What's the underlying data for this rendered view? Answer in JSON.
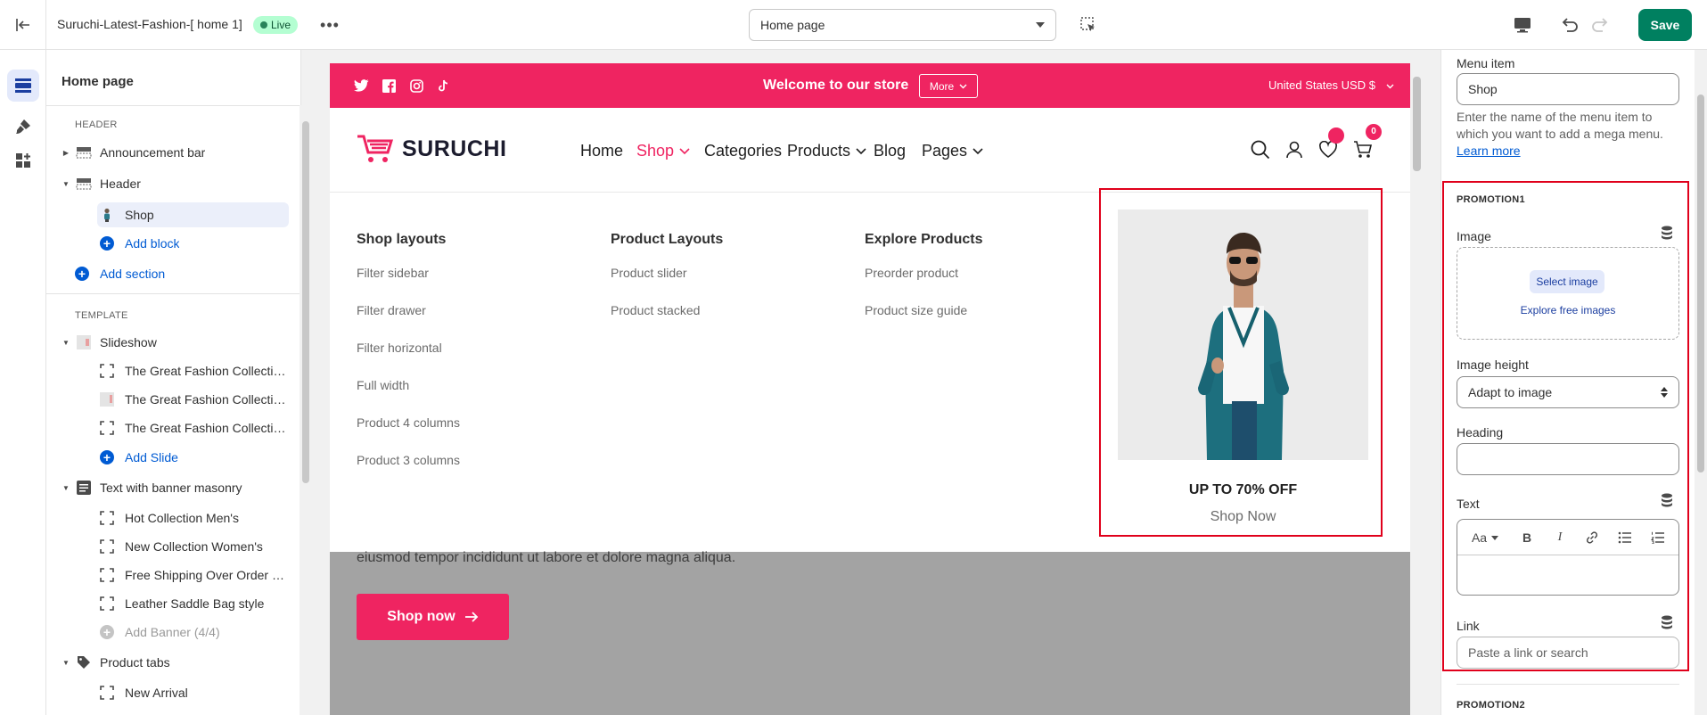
{
  "topbar": {
    "theme_name": "Suruchi-Latest-Fashion-[ home 1]",
    "live_badge": "Live",
    "page_selector": "Home page",
    "save_label": "Save"
  },
  "left_panel": {
    "title": "Home page",
    "header_section_label": "HEADER",
    "template_section_label": "TEMPLATE",
    "items": {
      "announcement_bar": "Announcement bar",
      "header": "Header",
      "shop": "Shop",
      "add_block": "Add block",
      "add_section": "Add section",
      "slideshow": "Slideshow",
      "slide1": "The Great Fashion Collectio...",
      "slide2": "The Great Fashion Collectio...",
      "slide3": "The Great Fashion Collectio...",
      "add_slide": "Add Slide",
      "text_banner": "Text with banner masonry",
      "banner1": "Hot Collection Men's",
      "banner2": "New Collection Women's",
      "banner3": "Free Shipping Over Order $...",
      "banner4": "Leather Saddle Bag style",
      "add_banner": "Add Banner (4/4)",
      "product_tabs": "Product tabs",
      "new_arrival": "New Arrival"
    }
  },
  "preview": {
    "announcement": {
      "text": "Welcome to our store",
      "more": "More",
      "currency": "United States USD $"
    },
    "logo_text": "SURUCHI",
    "nav": [
      "Home",
      "Shop",
      "Categories",
      "Products",
      "Blog",
      "Pages"
    ],
    "cart_count": "0",
    "mega_columns": [
      {
        "title": "Shop layouts",
        "items": [
          "Filter sidebar",
          "Filter drawer",
          "Filter horizontal",
          "Full width",
          "Product 4 columns",
          "Product 3 columns"
        ]
      },
      {
        "title": "Product Layouts",
        "items": [
          "Product slider",
          "Product stacked"
        ]
      },
      {
        "title": "Explore Products",
        "items": [
          "Preorder product",
          "Product size guide"
        ]
      }
    ],
    "promo": {
      "heading": "UP TO 70% OFF",
      "link": "Shop Now"
    },
    "hero_text": "eiusmod tempor incididunt ut labore et dolore magna aliqua.",
    "hero_button": "Shop now"
  },
  "settings": {
    "menu_item_label": "Menu item",
    "menu_item_value": "Shop",
    "menu_item_help": "Enter the name of the menu item to which you want to add a mega menu.",
    "learn_more": "Learn more",
    "promotion1": "PROMOTION1",
    "image_label": "Image",
    "select_image": "Select image",
    "explore_free": "Explore free images",
    "image_height_label": "Image height",
    "image_height_value": "Adapt to image",
    "heading_label": "Heading",
    "heading_value": "",
    "text_label": "Text",
    "rte_font": "Aa",
    "link_label": "Link",
    "link_placeholder": "Paste a link or search",
    "promotion2": "PROMOTION2"
  },
  "colors": {
    "accent": "#ef2461",
    "save": "#008060",
    "link": "#005bd3",
    "highlight": "#e0001b"
  }
}
